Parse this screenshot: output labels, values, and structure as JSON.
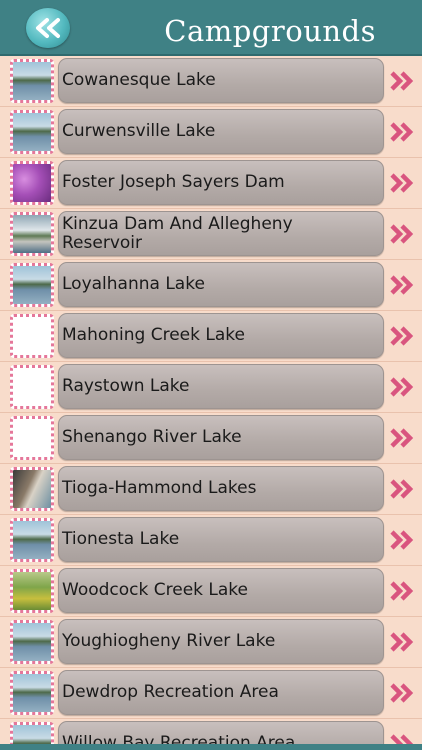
{
  "header": {
    "title": "Campgrounds",
    "back_icon": "double-chevron-left-icon"
  },
  "colors": {
    "header_bg": "#3f8185",
    "row_bg": "#f8dccb",
    "item_bg": "#b3aaa7",
    "chevron": "#d9557f",
    "thumb_border": "#e5779a"
  },
  "items": [
    {
      "label": "Cowanesque Lake",
      "thumb": "lake-photo"
    },
    {
      "label": "Curwensville Lake",
      "thumb": "lake-photo"
    },
    {
      "label": "Foster Joseph Sayers Dam",
      "thumb": "purple-trees-photo"
    },
    {
      "label": "Kinzua Dam And Allegheny Reservoir",
      "thumb": "dam-photo"
    },
    {
      "label": "Loyalhanna Lake",
      "thumb": "lake-photo"
    },
    {
      "label": "Mahoning Creek Lake",
      "thumb": "blank"
    },
    {
      "label": "Raystown Lake",
      "thumb": "blank"
    },
    {
      "label": "Shenango River Lake",
      "thumb": "blank"
    },
    {
      "label": "Tioga-Hammond Lakes",
      "thumb": "rocks-photo"
    },
    {
      "label": "Tionesta Lake",
      "thumb": "lake-photo"
    },
    {
      "label": "Woodcock Creek Lake",
      "thumb": "meadow-photo"
    },
    {
      "label": "Youghiogheny River Lake",
      "thumb": "lake-photo"
    },
    {
      "label": "Dewdrop Recreation Area",
      "thumb": "lake-photo"
    },
    {
      "label": "Willow Bay Recreation Area",
      "thumb": "lake-photo"
    }
  ]
}
